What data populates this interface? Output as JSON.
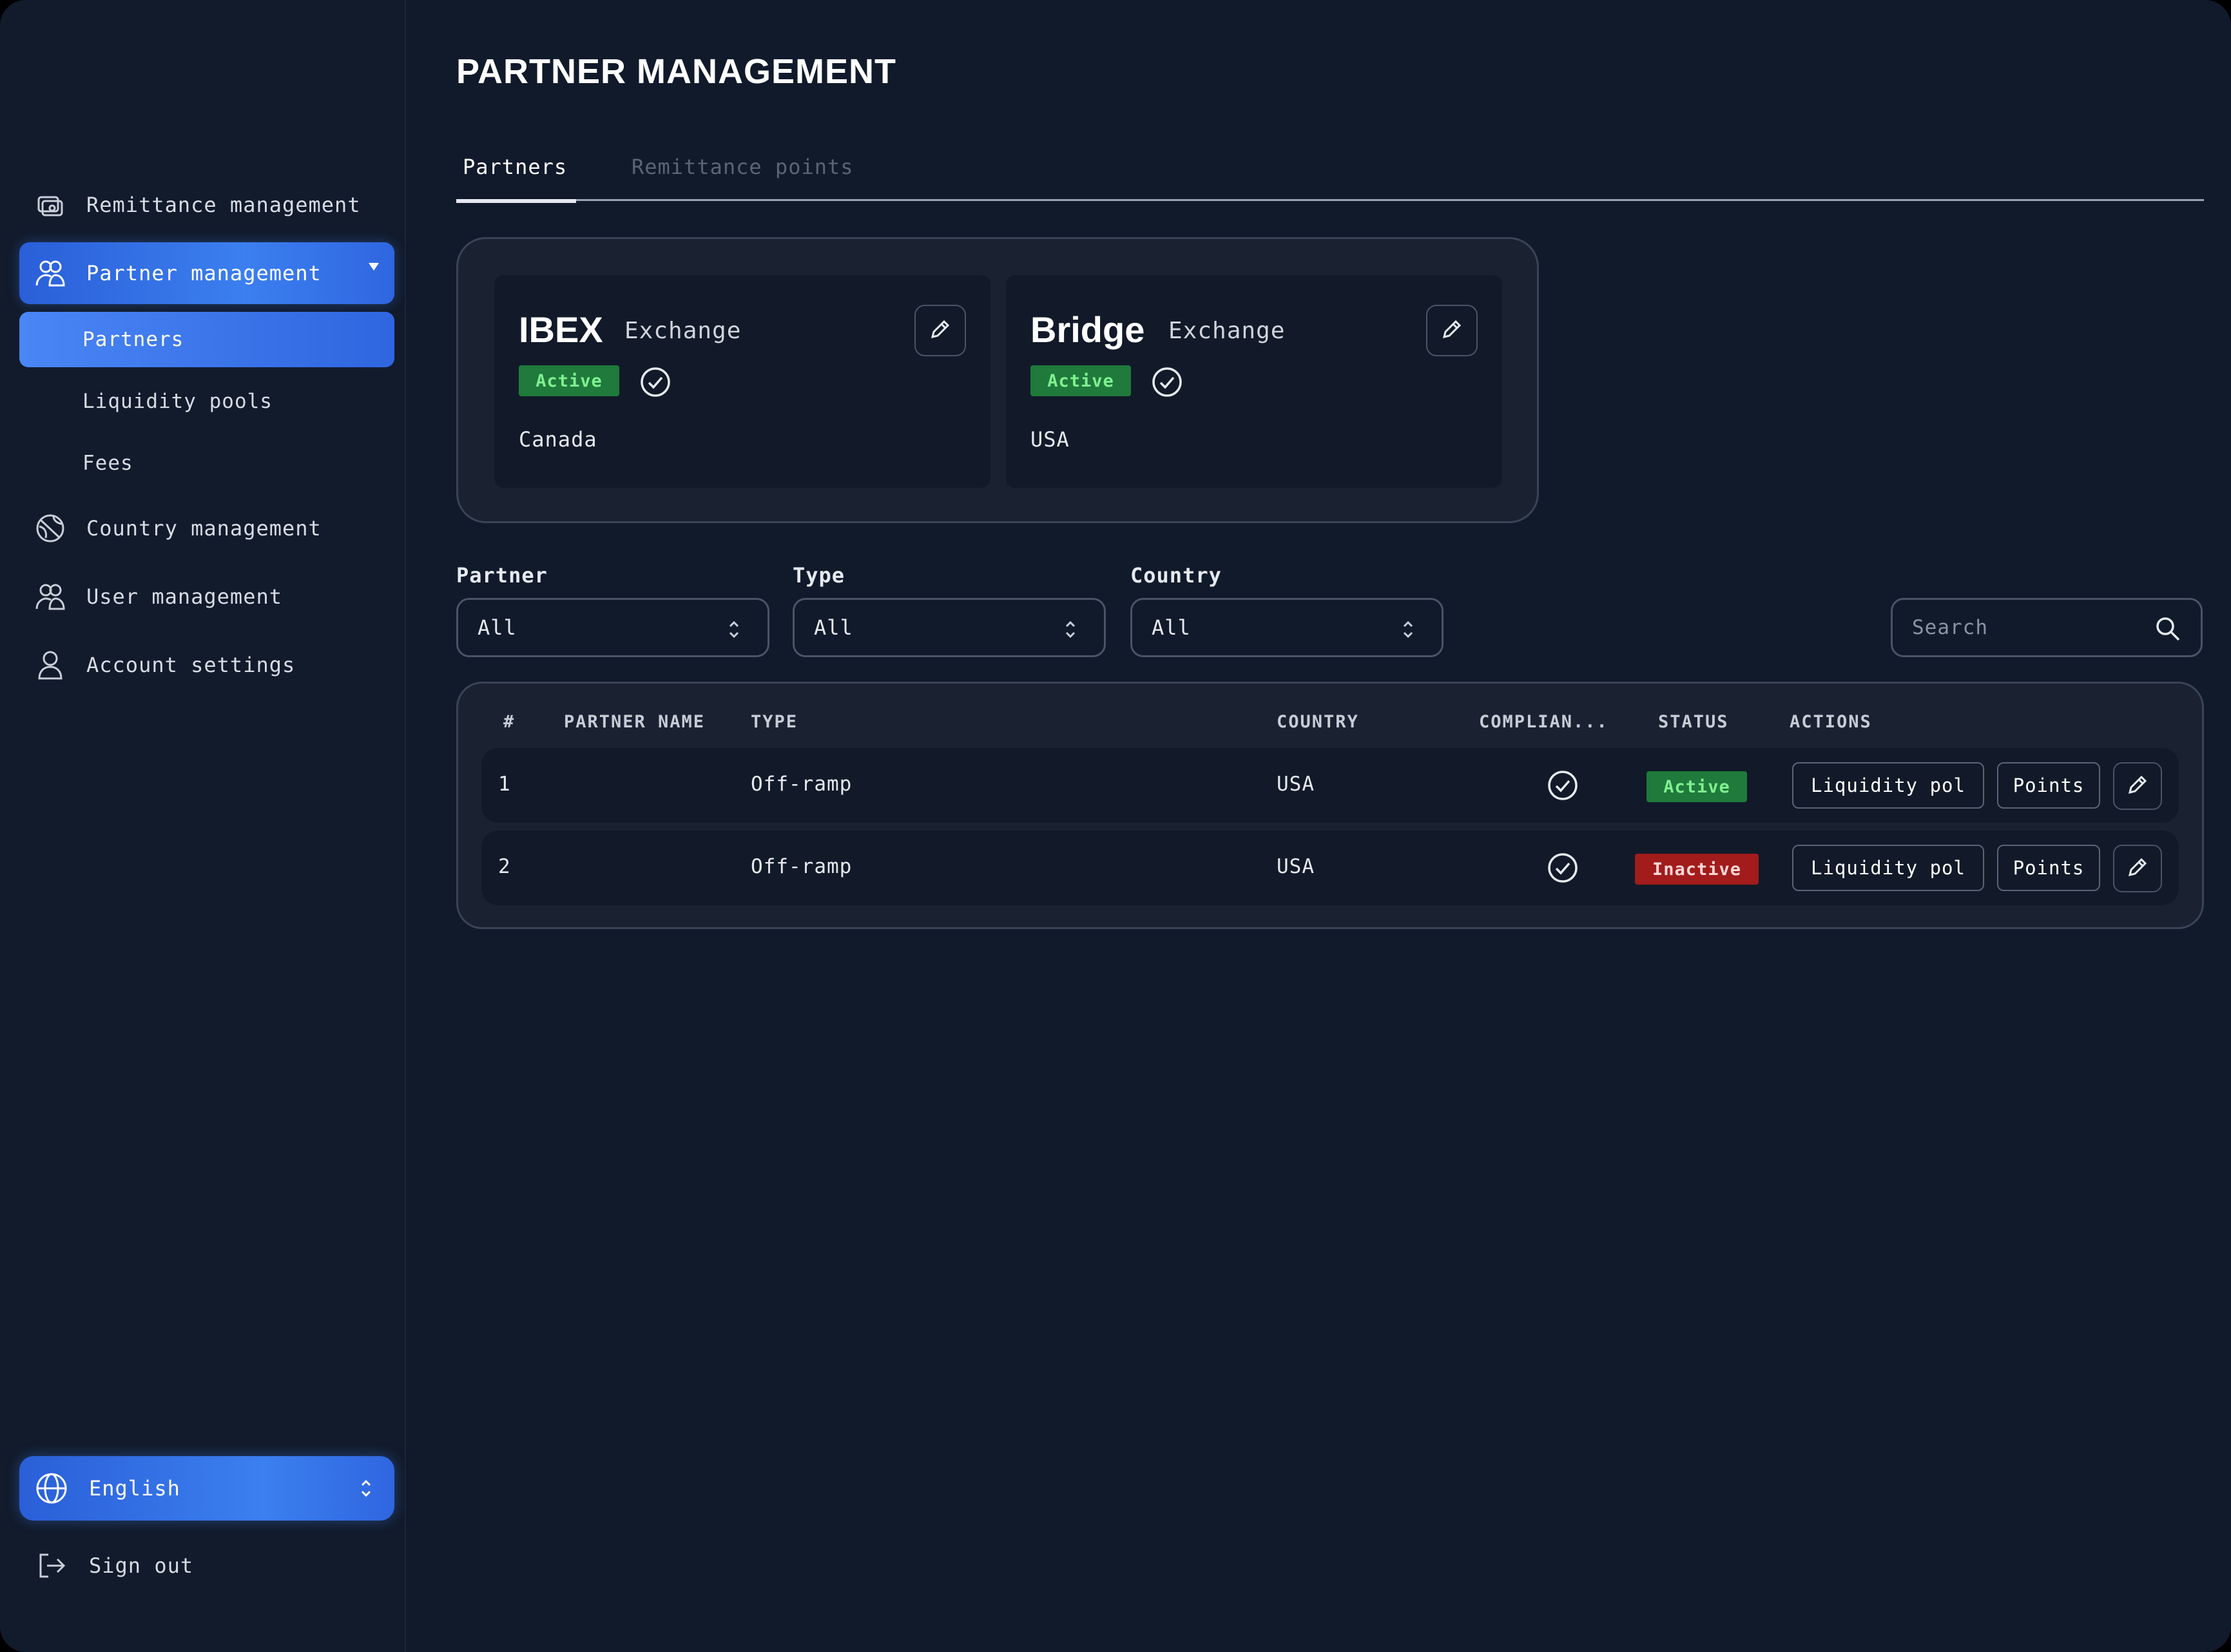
{
  "sidebar": {
    "items": [
      {
        "label": "Remittance management",
        "icon": "remittance-icon"
      },
      {
        "label": "Partner management",
        "icon": "partner-icon",
        "expanded": true,
        "children": [
          {
            "label": "Partners",
            "active": true
          },
          {
            "label": "Liquidity pools"
          },
          {
            "label": "Fees"
          }
        ]
      },
      {
        "label": "Country management",
        "icon": "globe-slash-icon"
      },
      {
        "label": "User management",
        "icon": "users-icon"
      },
      {
        "label": "Account settings",
        "icon": "person-icon"
      }
    ],
    "language": "English",
    "sign_out": "Sign out"
  },
  "main": {
    "title": "PARTNER MANAGEMENT",
    "tabs": [
      {
        "label": "Partners",
        "active": true
      },
      {
        "label": "Remittance points",
        "active": false
      }
    ],
    "partner_cards": [
      {
        "name": "IBEX",
        "type": "Exchange",
        "status": "Active",
        "country": "Canada"
      },
      {
        "name": "Bridge",
        "type": "Exchange",
        "status": "Active",
        "country": "USA"
      }
    ],
    "filters": {
      "partner": {
        "label": "Partner",
        "value": "All"
      },
      "type": {
        "label": "Type",
        "value": "All"
      },
      "country": {
        "label": "Country",
        "value": "All"
      },
      "search_placeholder": "Search"
    },
    "table": {
      "headers": [
        "#",
        "PARTNER NAME",
        "TYPE",
        "COUNTRY",
        "COMPLIAN...",
        "STATUS",
        "ACTIONS"
      ],
      "rows": [
        {
          "num": "1",
          "partner_name": "",
          "type": "Off-ramp",
          "country": "USA",
          "status": "Active",
          "actions": {
            "liquidity": "Liquidity pol",
            "points": "Points"
          }
        },
        {
          "num": "2",
          "partner_name": "",
          "type": "Off-ramp",
          "country": "USA",
          "status": "Inactive",
          "actions": {
            "liquidity": "Liquidity pol",
            "points": "Points"
          }
        }
      ]
    }
  },
  "colors": {
    "background": "#111a2b",
    "accent": "#3b7ff0",
    "active_badge": "#1f7a3b",
    "inactive_badge": "#a21c1c"
  }
}
